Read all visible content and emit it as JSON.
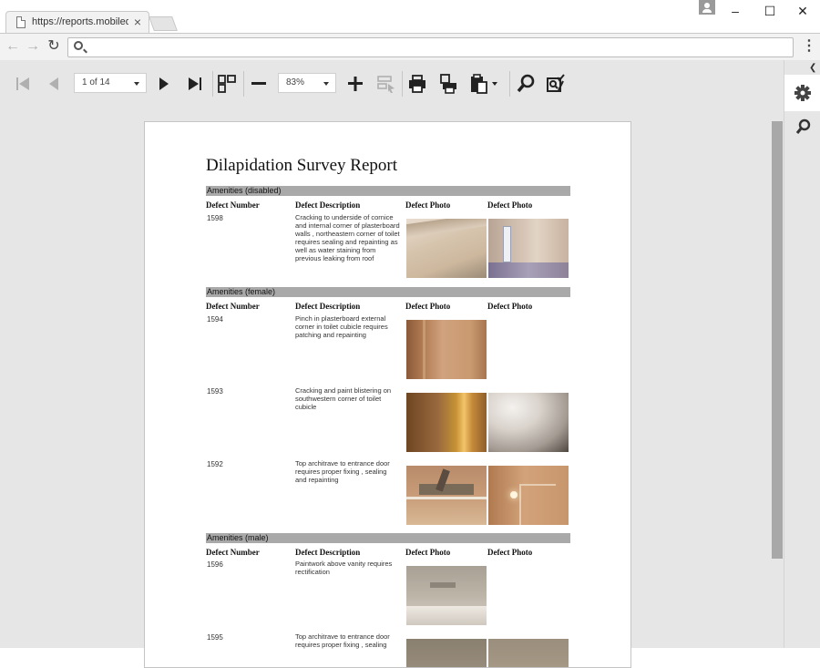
{
  "browser": {
    "tab_title": "https://reports.mobiledata...",
    "tab_close": "×",
    "address": "",
    "window_controls": [
      "minimize",
      "maximize",
      "close"
    ]
  },
  "toolbar": {
    "page_indicator": "1 of 14",
    "zoom": "83%",
    "icons": [
      "first-page-icon",
      "prev-page-icon",
      "next-page-icon",
      "last-page-icon",
      "multi-page-icon",
      "zoom-out-icon",
      "zoom-in-icon",
      "highlight-editing-icon",
      "print-icon",
      "print-page-icon",
      "export-icon",
      "search-icon",
      "parameters-icon"
    ]
  },
  "sidepanel": {
    "icons": [
      "collapse-icon",
      "gear-icon",
      "search-icon"
    ]
  },
  "report": {
    "title": "Dilapidation Survey Report",
    "columns": {
      "number": "Defect Number",
      "description": "Defect Description",
      "photo1": "Defect Photo",
      "photo2": "Defect Photo"
    },
    "sections": [
      {
        "name": "Amenities (disabled)",
        "rows": [
          {
            "number": "1598",
            "description": "Cracking to underside of cornice and internal corner of plasterboard walls , northeastern corner of toilet requires sealing and repainting as well as water staining from previous leaking from roof"
          }
        ]
      },
      {
        "name": "Amenities (female)",
        "rows": [
          {
            "number": "1594",
            "description": "Pinch in plasterboard external corner in toilet cubicle requires patching and repainting"
          },
          {
            "number": "1593",
            "description": "Cracking and paint blistering on southwestern corner of toilet cubicle"
          },
          {
            "number": "1592",
            "description": "Top architrave to entrance door requires proper fixing , sealing and repainting"
          }
        ]
      },
      {
        "name": "Amenities (male)",
        "rows": [
          {
            "number": "1596",
            "description": "Paintwork above vanity requires rectification"
          },
          {
            "number": "1595",
            "description": "Top architrave to entrance door requires proper fixing , sealing"
          }
        ]
      }
    ]
  }
}
